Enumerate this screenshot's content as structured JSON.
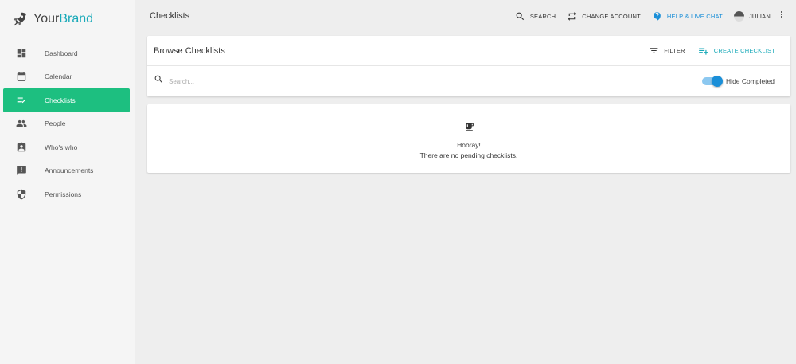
{
  "brand": {
    "name_part1": "Your",
    "name_part2": "Brand",
    "logo_icon": "rocket-icon",
    "accent_color": "#18a9b8"
  },
  "sidebar": {
    "items": [
      {
        "label": "Dashboard",
        "icon": "dashboard-icon",
        "active": false
      },
      {
        "label": "Calendar",
        "icon": "calendar-icon",
        "active": false
      },
      {
        "label": "Checklists",
        "icon": "checklist-icon",
        "active": true
      },
      {
        "label": "People",
        "icon": "people-icon",
        "active": false
      },
      {
        "label": "Who's who",
        "icon": "badge-icon",
        "active": false
      },
      {
        "label": "Announcements",
        "icon": "announcement-icon",
        "active": false
      },
      {
        "label": "Permissions",
        "icon": "shield-icon",
        "active": false
      }
    ],
    "active_color": "#1dbf80"
  },
  "header": {
    "title": "Checklists",
    "search_label": "SEARCH",
    "change_account_label": "CHANGE ACCOUNT",
    "help_label": "HELP & LIVE CHAT",
    "user_label": "JULIAN",
    "help_color": "#1a8fd8"
  },
  "browse": {
    "title": "Browse Checklists",
    "filter_label": "FILTER",
    "create_label": "CREATE CHECKLIST",
    "search_placeholder": "Search...",
    "hide_completed_label": "Hide Completed",
    "hide_completed_on": true
  },
  "empty_state": {
    "icon": "coffee-icon",
    "title": "Hooray!",
    "message": "There are no pending checklists."
  }
}
